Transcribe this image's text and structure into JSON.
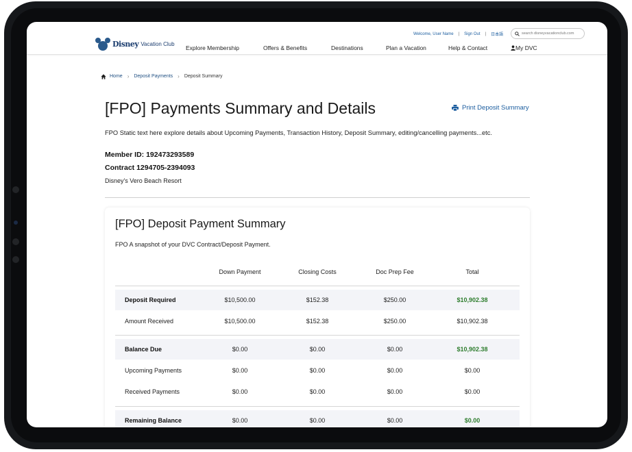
{
  "header": {
    "logo_brand": "Disney",
    "logo_sub": "Vacation Club",
    "welcome": "Welcome, User Name",
    "sign_out": "Sign Out",
    "language": "日本語",
    "search_placeholder": "search disneyvacationclub.com",
    "nav": [
      "Explore Membership",
      "Offers & Benefits",
      "Destinations",
      "Plan a Vacation",
      "Help & Contact",
      "My DVC"
    ]
  },
  "breadcrumb": [
    "Home",
    "Deposit Payments",
    "Deposit Summary"
  ],
  "page": {
    "title": "[FPO] Payments Summary and Details",
    "print_label": "Print Deposit Summary",
    "intro": "FPO Static text here explore details about Upcoming Payments, Transaction History, Deposit Summary, editing/cancelling payments...etc.",
    "member_id": "Member ID: 192473293589",
    "contract": "Contract 1294705-2394093",
    "resort": "Disney's Vero Beach Resort"
  },
  "summary": {
    "title": "[FPO] Deposit Payment Summary",
    "subtitle": "FPO A snapshot of your DVC Contract/Deposit Payment.",
    "columns": [
      "Down Payment",
      "Closing Costs",
      "Doc Prep Fee",
      "Total"
    ],
    "rows": [
      {
        "label": "Deposit Required",
        "values": [
          "$10,500.00",
          "$152.38",
          "$250.00",
          "$10,902.38"
        ]
      },
      {
        "label": "Amount Received",
        "values": [
          "$10,500.00",
          "$152.38",
          "$250.00",
          "$10,902.38"
        ]
      },
      {
        "label": "Balance Due",
        "values": [
          "$0.00",
          "$0.00",
          "$0.00",
          "$10,902.38"
        ]
      },
      {
        "label": "Upcoming Payments",
        "values": [
          "$0.00",
          "$0.00",
          "$0.00",
          "$0.00"
        ]
      },
      {
        "label": "Received Payments",
        "values": [
          "$0.00",
          "$0.00",
          "$0.00",
          "$0.00"
        ]
      },
      {
        "label": "Remaining Balance",
        "values": [
          "$0.00",
          "$0.00",
          "$0.00",
          "$0.00"
        ]
      }
    ]
  },
  "colors": {
    "accent": "#1a5c9e",
    "positive": "#2e7d2e",
    "row_shade": "#f3f4f8"
  },
  "icons": {
    "home": "home-icon",
    "print": "printer-icon",
    "search": "search-icon",
    "user": "user-icon",
    "chevron": "chevron-right-icon"
  }
}
